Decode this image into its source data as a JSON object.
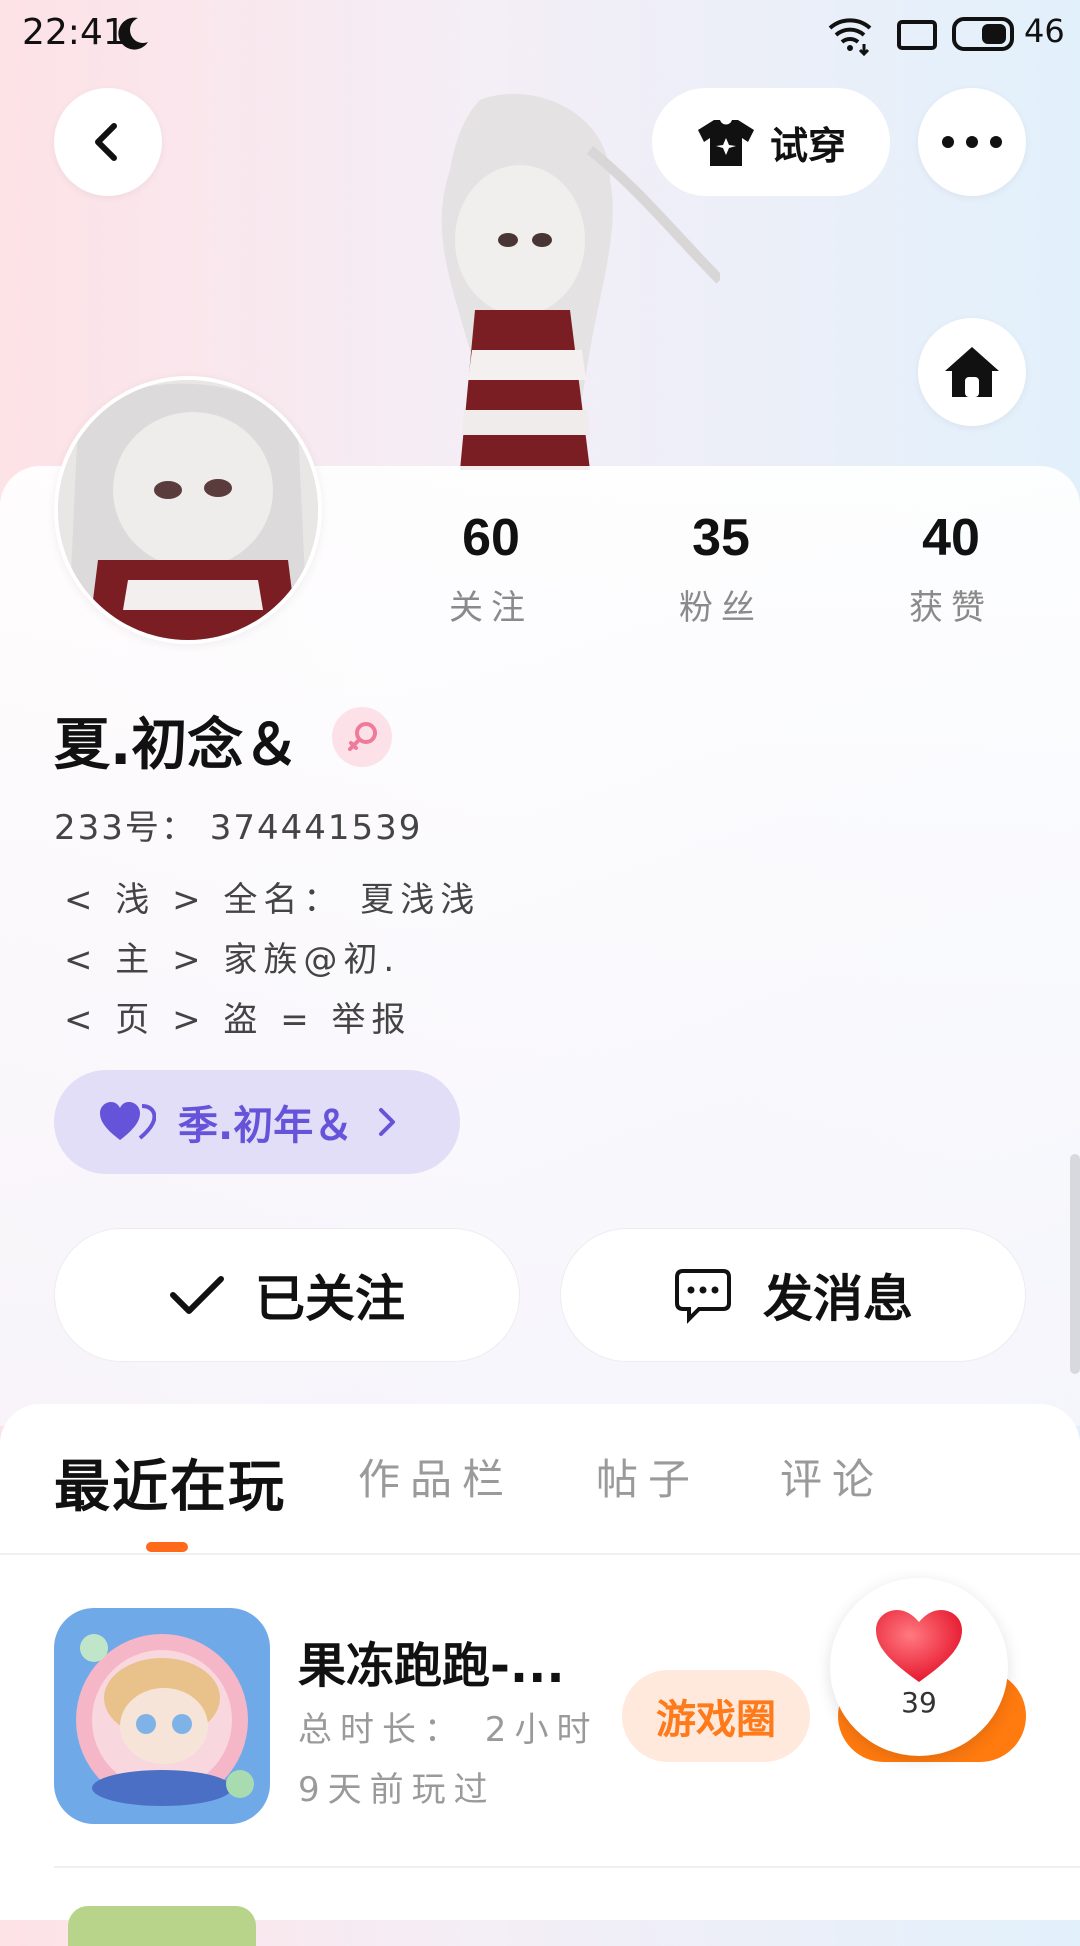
{
  "status_bar": {
    "time": "22:41",
    "battery": "46"
  },
  "header": {
    "tryon_label": "试穿"
  },
  "stats": [
    {
      "value": "60",
      "label": "关注"
    },
    {
      "value": "35",
      "label": "粉丝"
    },
    {
      "value": "40",
      "label": "获赞"
    }
  ],
  "profile": {
    "name": "夏.初念＆",
    "uid_line": "233号： 374441539",
    "bio": [
      "< 浅 > 全名： 夏浅浅",
      "< 主 > 家族@初.",
      "< 页 > 盗 = 举报"
    ],
    "family_name": "季.初年＆"
  },
  "actions": {
    "follow_label": "已关注",
    "message_label": "发消息"
  },
  "tabs": [
    {
      "label": "最近在玩",
      "active": true
    },
    {
      "label": "作品栏",
      "active": false
    },
    {
      "label": "帖子",
      "active": false
    },
    {
      "label": "评论",
      "active": false
    }
  ],
  "recent_game": {
    "title": "果冻跑跑-...",
    "duration": "总时长： 2小时",
    "last_played": "9天前玩过",
    "circle_label": "游戏圈",
    "likes": "39"
  },
  "colors": {
    "accent": "#ff7a0f",
    "family_text": "#6554d9",
    "family_bg": "#e2def7"
  }
}
